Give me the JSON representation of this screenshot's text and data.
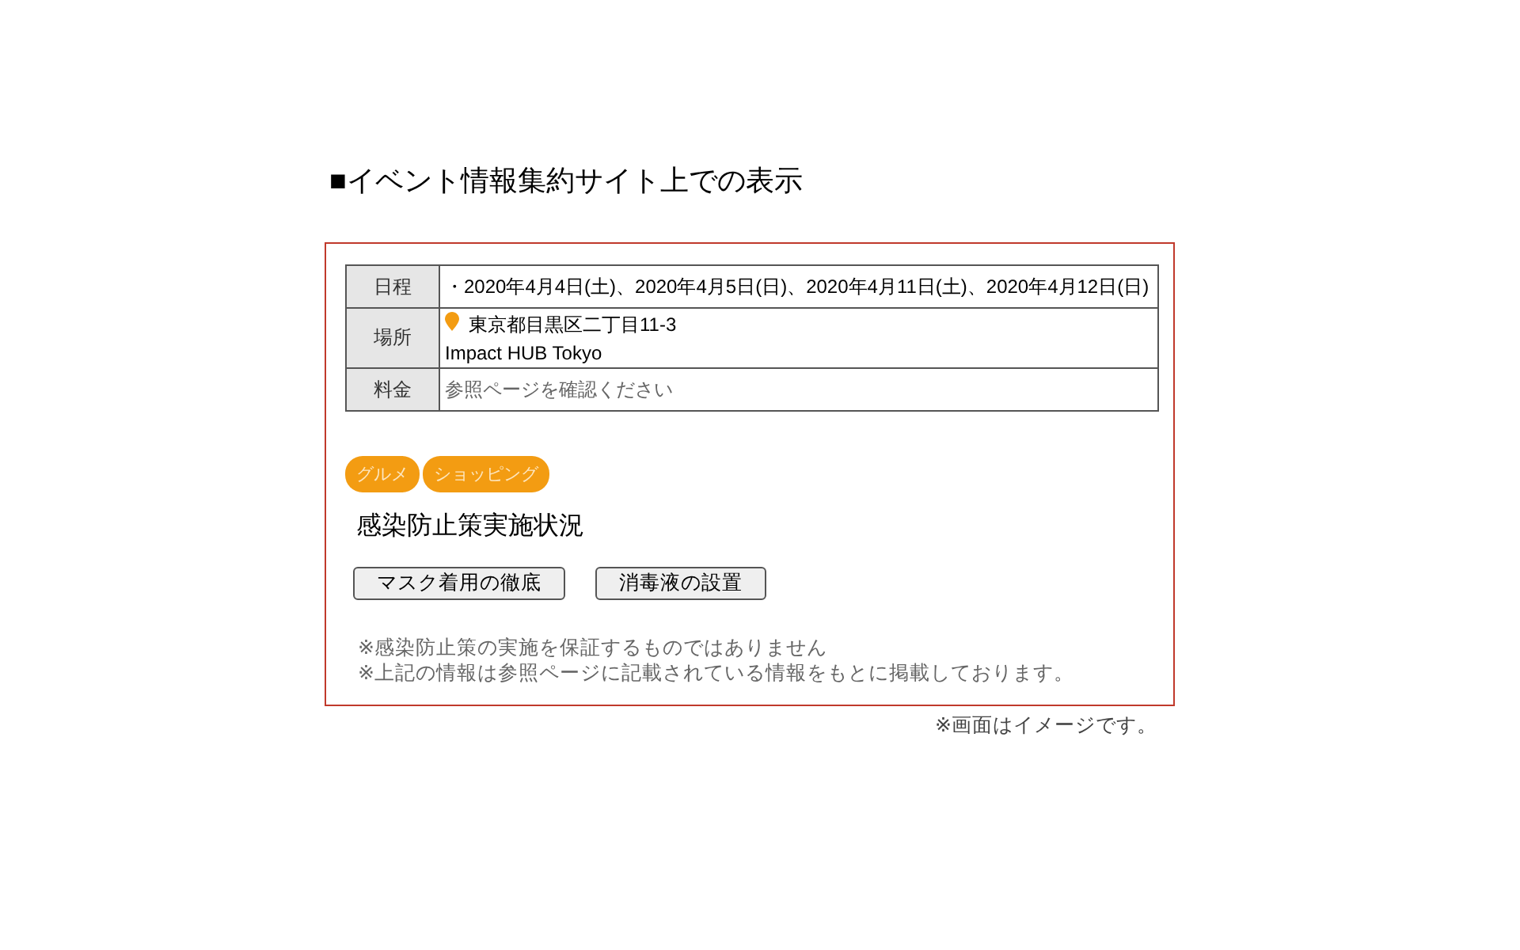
{
  "heading": "■イベント情報集約サイト上での表示",
  "info_table": [
    {
      "kind": "text",
      "label": "日程",
      "lines": [
        "・2020年4月4日(土)、2020年4月5日(日)、2020年4月11日(土)、2020年4月12日(日)"
      ]
    },
    {
      "kind": "location",
      "label": "場所",
      "lines": [
        "東京都目黒区二丁目11-3",
        "Impact HUB Tokyo"
      ]
    },
    {
      "kind": "muted",
      "label": "料金",
      "lines": [
        "参照ページを確認ください"
      ]
    }
  ],
  "tags": [
    "グルメ",
    "ショッピング"
  ],
  "section_title": "感染防止策実施状況",
  "measures": [
    "マスク着用の徹底",
    "消毒液の設置"
  ],
  "notes": [
    "※感染防止策の実施を保証するものではありません",
    "※上記の情報は参照ページに記載されている情報をもとに掲載しております。"
  ],
  "caption": "※画面はイメージです。"
}
